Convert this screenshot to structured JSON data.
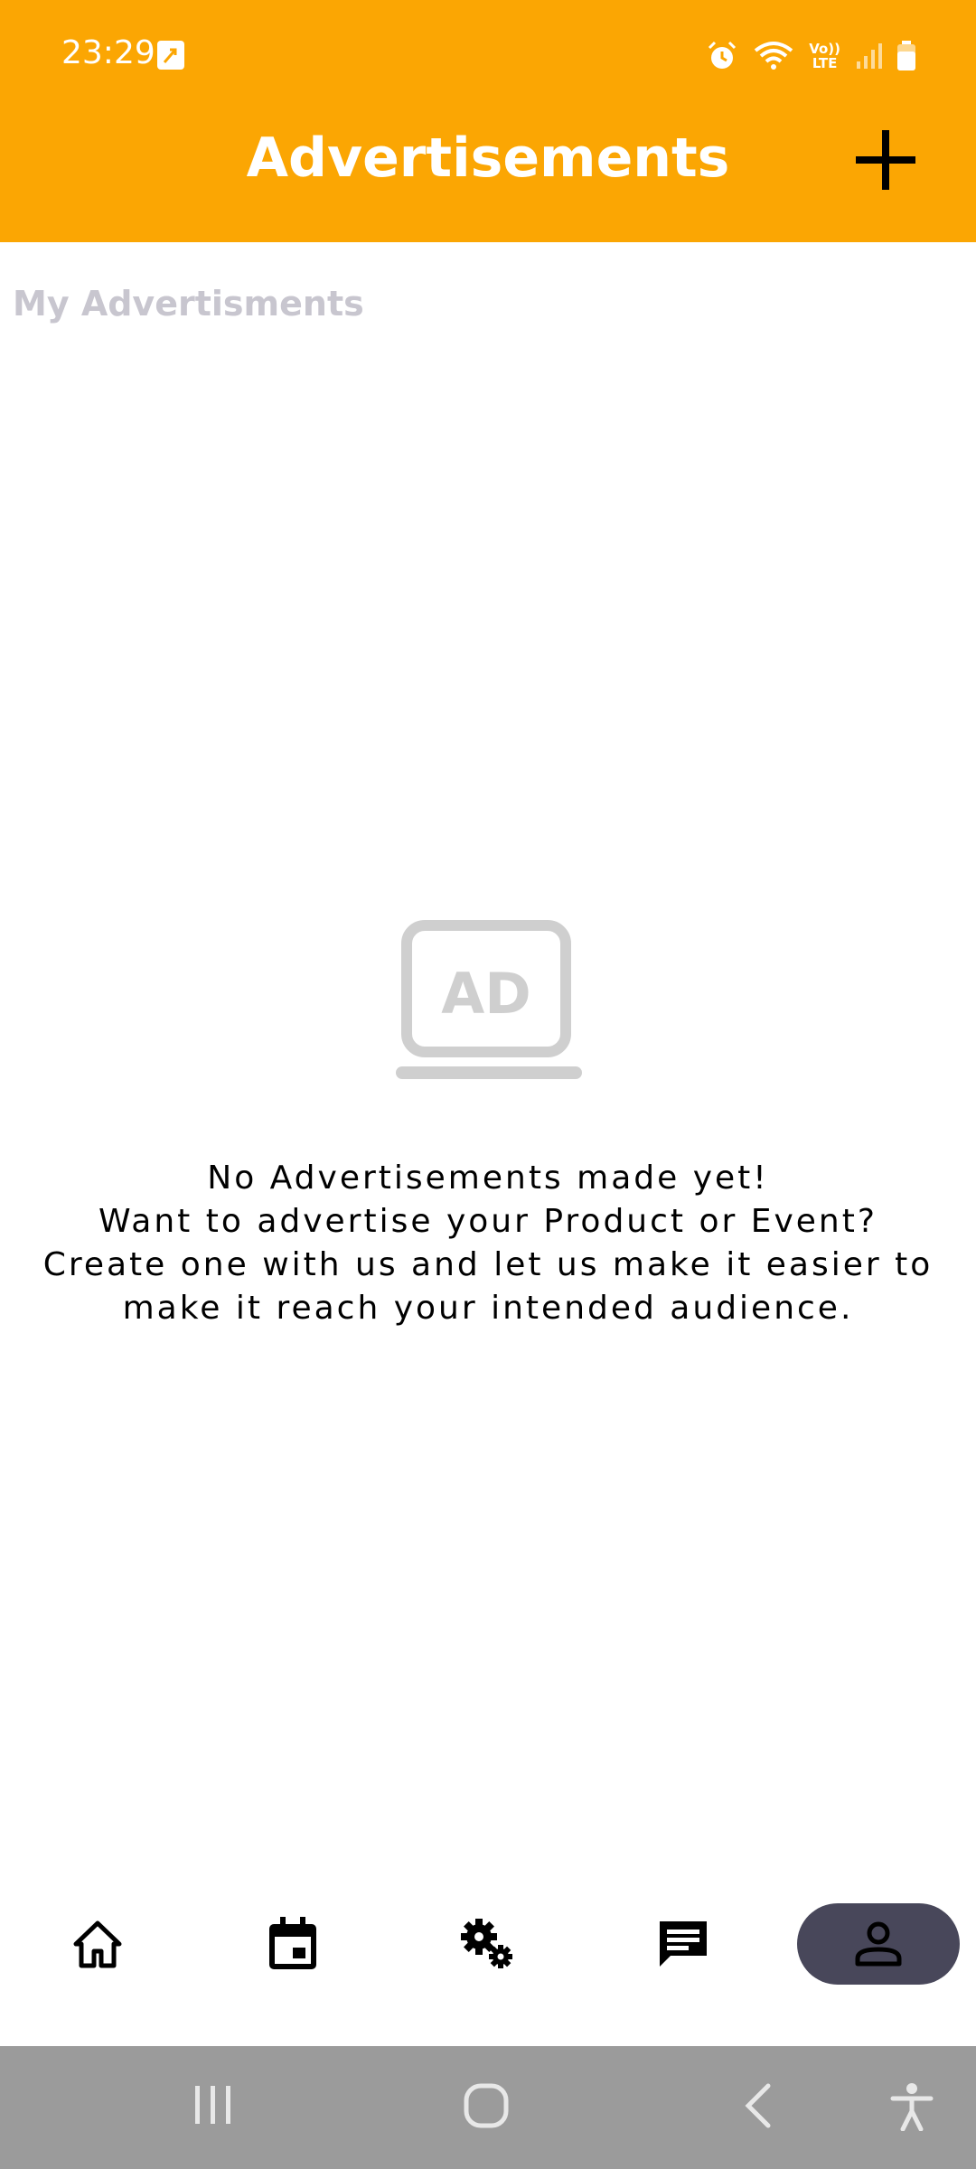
{
  "status_bar": {
    "time": "23:29",
    "icons": [
      "call-forward-icon",
      "alarm-icon",
      "wifi-icon",
      "volte-icon",
      "signal-icon",
      "battery-icon"
    ],
    "volte_label_top": "Vo))",
    "volte_label_bottom": "LTE"
  },
  "header": {
    "title": "Advertisements",
    "action_icon": "plus-icon",
    "background_color": "#FBA603"
  },
  "section": {
    "label": "My Advertisments"
  },
  "empty_state": {
    "icon": "ad-screen-icon",
    "icon_text": "AD",
    "lines": [
      "No Advertisements made yet!",
      "Want to advertise your Product or Event?",
      "Create one with us and let us make it easier to",
      "make it reach your intended audience."
    ]
  },
  "bottom_nav": {
    "items": [
      {
        "name": "home",
        "icon": "home-icon",
        "active": false
      },
      {
        "name": "calendar",
        "icon": "calendar-icon",
        "active": false
      },
      {
        "name": "settings",
        "icon": "gears-icon",
        "active": false
      },
      {
        "name": "messages",
        "icon": "message-icon",
        "active": false
      },
      {
        "name": "profile",
        "icon": "person-icon",
        "active": true
      }
    ],
    "active_color": "#48475A"
  },
  "system_nav": {
    "buttons": [
      "recents-icon",
      "home-circle-icon",
      "back-icon",
      "accessibility-icon"
    ]
  }
}
